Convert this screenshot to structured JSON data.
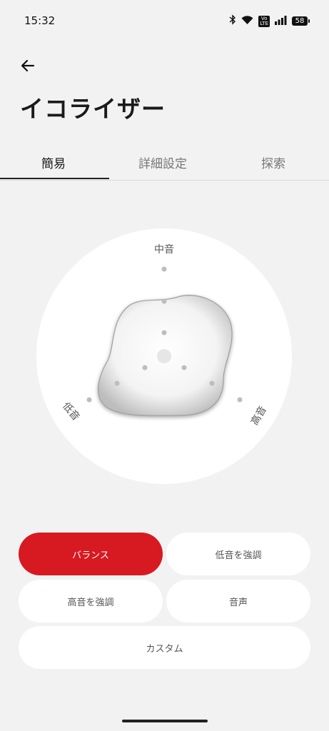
{
  "status_bar": {
    "time": "15:32",
    "volte_label": "Vo\nLTE",
    "battery": "58",
    "icons": [
      "bluetooth-icon",
      "wifi-icon",
      "volte-icon",
      "signal-icon",
      "battery-icon"
    ]
  },
  "page": {
    "back_icon": "arrow-left-icon",
    "title": "イコライザー"
  },
  "tabs": [
    {
      "label": "簡易",
      "active": true
    },
    {
      "label": "詳細設定",
      "active": false
    },
    {
      "label": "探索",
      "active": false
    }
  ],
  "equalizer": {
    "labels": {
      "mid": "中音",
      "bass": "低音",
      "treble": "高音"
    }
  },
  "presets": [
    {
      "label": "バランス",
      "selected": true
    },
    {
      "label": "低音を強調",
      "selected": false
    },
    {
      "label": "高音を強調",
      "selected": false
    },
    {
      "label": "音声",
      "selected": false
    },
    {
      "label": "カスタム",
      "selected": false
    }
  ],
  "colors": {
    "accent": "#d71921",
    "background": "#f2f2f2",
    "card": "#ffffff"
  }
}
